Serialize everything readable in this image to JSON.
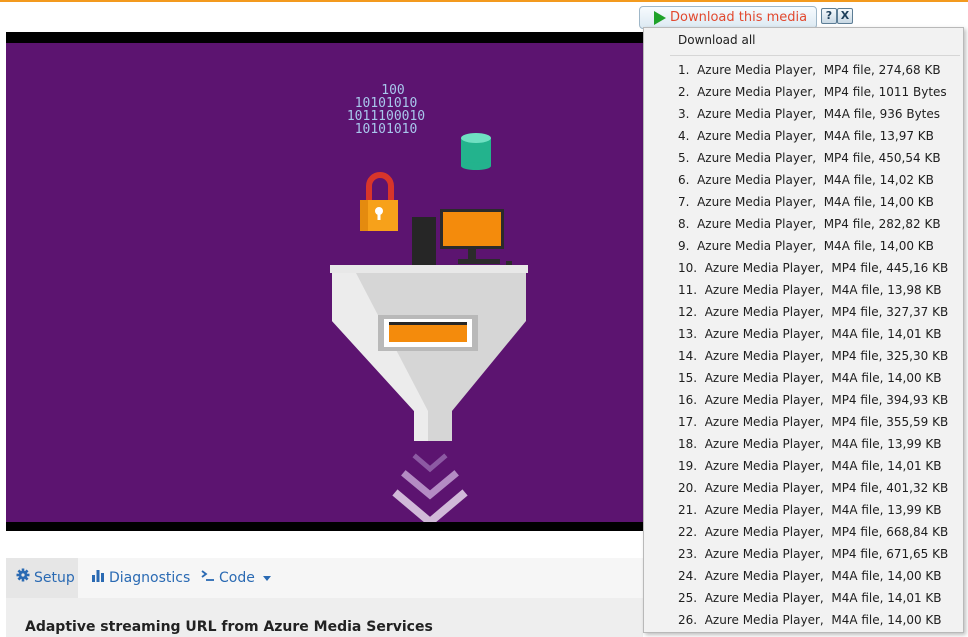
{
  "video": {
    "binary_lines": [
      "100",
      "10101010",
      "1011100010",
      "10101010"
    ]
  },
  "tabs": [
    {
      "label": "Setup",
      "icon": "gear-icon"
    },
    {
      "label": "Diagnostics",
      "icon": "bar-chart-icon"
    },
    {
      "label": "Code",
      "icon": "terminal-icon"
    }
  ],
  "panel": {
    "heading": "Adaptive streaming URL from Azure Media Services"
  },
  "download": {
    "button_label": "Download this media",
    "help_label": "?",
    "close_label": "X",
    "download_all": "Download all",
    "items": [
      "1.  Azure Media Player,  MP4 file, 274,68 KB",
      "2.  Azure Media Player,  MP4 file, 1011 Bytes",
      "3.  Azure Media Player,  M4A file, 936 Bytes",
      "4.  Azure Media Player,  M4A file, 13,97 KB",
      "5.  Azure Media Player,  MP4 file, 450,54 KB",
      "6.  Azure Media Player,  M4A file, 14,02 KB",
      "7.  Azure Media Player,  M4A file, 14,00 KB",
      "8.  Azure Media Player,  MP4 file, 282,82 KB",
      "9.  Azure Media Player,  M4A file, 14,00 KB",
      "10.  Azure Media Player,  MP4 file, 445,16 KB",
      "11.  Azure Media Player,  M4A file, 13,98 KB",
      "12.  Azure Media Player,  MP4 file, 327,37 KB",
      "13.  Azure Media Player,  M4A file, 14,01 KB",
      "14.  Azure Media Player,  MP4 file, 325,30 KB",
      "15.  Azure Media Player,  M4A file, 14,00 KB",
      "16.  Azure Media Player,  MP4 file, 394,93 KB",
      "17.  Azure Media Player,  MP4 file, 355,59 KB",
      "18.  Azure Media Player,  M4A file, 13,99 KB",
      "19.  Azure Media Player,  M4A file, 14,01 KB",
      "20.  Azure Media Player,  MP4 file, 401,32 KB",
      "21.  Azure Media Player,  M4A file, 13,99 KB",
      "22.  Azure Media Player,  MP4 file, 668,84 KB",
      "23.  Azure Media Player,  MP4 file, 671,65 KB",
      "24.  Azure Media Player,  M4A file, 14,00 KB",
      "25.  Azure Media Player,  M4A file, 14,01 KB",
      "26.  Azure Media Player,  M4A file, 14,00 KB"
    ]
  },
  "colors": {
    "accent": "#f39a1e",
    "video_background": "#5c1470",
    "link": "#2a6ab3",
    "download_label": "#e2492f"
  }
}
